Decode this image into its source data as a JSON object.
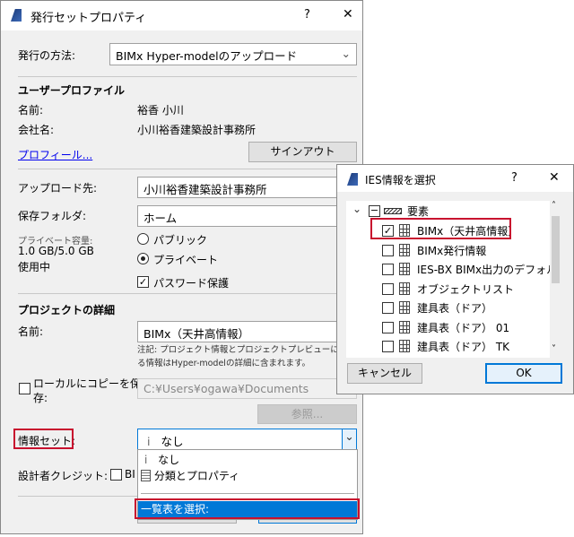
{
  "main_dialog": {
    "title": "発行セットプロパティ",
    "help": "?",
    "close": "✕",
    "method_label": "発行の方法:",
    "method_value": "BIMx Hyper-modelのアップロード",
    "user_profile": {
      "heading": "ユーザープロファイル",
      "name_label": "名前:",
      "name_value": "裕香 小川",
      "company_label": "会社名:",
      "company_value": "小川裕香建築設計事務所",
      "profile_link": "プロフィール...",
      "signout_button": "サインアウト"
    },
    "upload": {
      "dest_label": "アップロード先:",
      "dest_value": "小川裕香建築設計事務所",
      "folder_label": "保存フォルダ:",
      "folder_value": "ホーム",
      "capacity_label": "プライベート容量:",
      "capacity_value": "1.0 GB/5.0 GB",
      "capacity_suffix": "使用中",
      "public_label": "パブリック",
      "private_label": "プライベート",
      "password_label": "パスワード保護"
    },
    "project": {
      "heading": "プロジェクトの詳細",
      "name_label": "名前:",
      "name_value": "BIMx（天井高情報）",
      "note_line1": "注記: プロジェクト情報とプロジェクトプレビューに設定され",
      "note_line2": "る情報はHyper-modelの詳細に含まれます。",
      "local_copy_line1": "ローカルにコピーを保",
      "local_copy_line2": "存:",
      "local_path": "C:¥Users¥ogawa¥Documents",
      "browse_button": "参照...",
      "infoset_label": "情報セット:",
      "infoset_value": "なし",
      "infoset_icon": "i",
      "credit_label": "設計者クレジット:",
      "credit_partial": "BI"
    },
    "dropdown": {
      "options": [
        {
          "icon": "i",
          "label": "なし"
        },
        {
          "icon": "list",
          "label": "分類とプロパティ"
        }
      ],
      "selected_option": "一覧表を選択:"
    }
  },
  "ies_dialog": {
    "title": "IES情報を選択",
    "help": "?",
    "close": "✕",
    "root_label": "要素",
    "items": [
      {
        "label": "BIMx（天井高情報）",
        "checked": true
      },
      {
        "label": "BIMx発行情報",
        "checked": false
      },
      {
        "label": "IES-BX BIMx出力のデフォルト",
        "checked": false
      },
      {
        "label": "オブジェクトリスト",
        "checked": false
      },
      {
        "label": "建具表（ドア）",
        "checked": false
      },
      {
        "label": "建具表（ドア） 01",
        "checked": false
      },
      {
        "label": "建具表（ドア） TK",
        "checked": false
      }
    ],
    "cancel_button": "キャンセル",
    "ok_button": "OK"
  },
  "colors": {
    "accent": "#0078d7",
    "highlight_box": "#c8102e",
    "link": "#0000ee"
  }
}
